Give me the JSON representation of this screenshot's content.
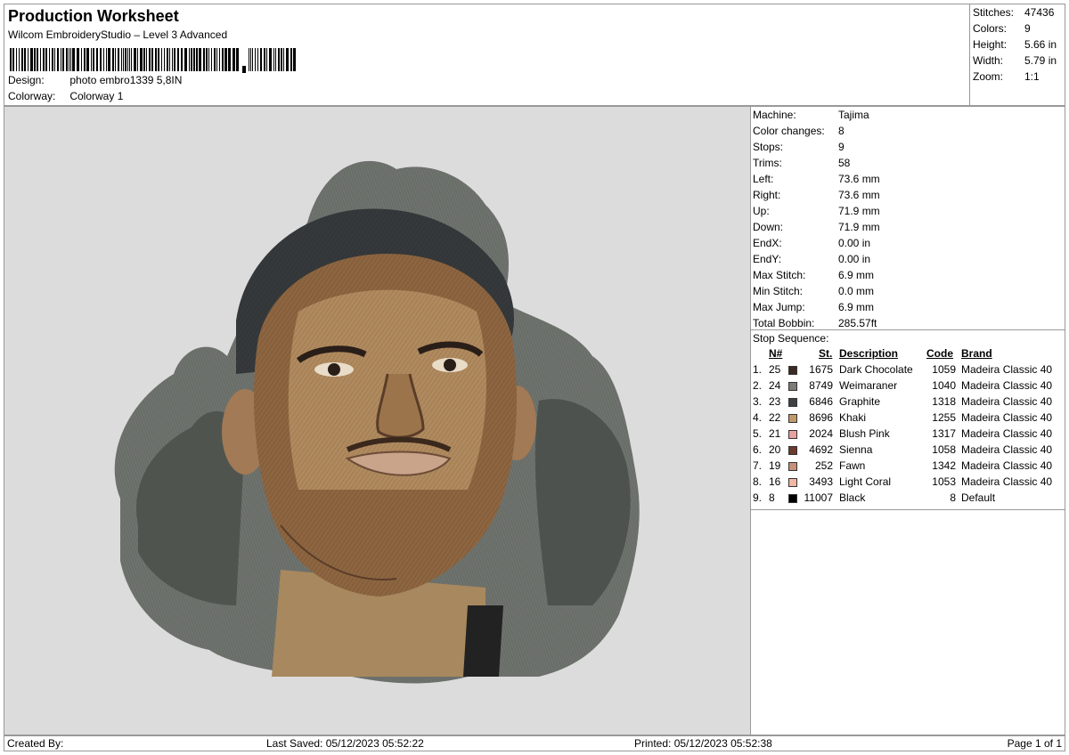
{
  "header": {
    "title": "Production Worksheet",
    "subtitle": "Wilcom EmbroideryStudio – Level 3 Advanced",
    "design_label": "Design:",
    "design_value": "photo embro1339 5,8IN",
    "colorway_label": "Colorway:",
    "colorway_value": "Colorway 1"
  },
  "stats": [
    {
      "label": "Stitches:",
      "value": "47436"
    },
    {
      "label": "Colors:",
      "value": "9"
    },
    {
      "label": "Height:",
      "value": "5.66 in"
    },
    {
      "label": "Width:",
      "value": "5.79 in"
    },
    {
      "label": "Zoom:",
      "value": "1:1"
    }
  ],
  "machine": [
    {
      "label": "Machine:",
      "value": "Tajima"
    },
    {
      "label": "Color changes:",
      "value": "8"
    },
    {
      "label": "Stops:",
      "value": "9"
    },
    {
      "label": "Trims:",
      "value": "58"
    },
    {
      "label": "Left:",
      "value": "73.6 mm"
    },
    {
      "label": "Right:",
      "value": "73.6 mm"
    },
    {
      "label": "Up:",
      "value": "71.9 mm"
    },
    {
      "label": "Down:",
      "value": "71.9 mm"
    },
    {
      "label": "EndX:",
      "value": "0.00 in"
    },
    {
      "label": "EndY:",
      "value": "0.00 in"
    },
    {
      "label": "Max Stitch:",
      "value": "6.9 mm"
    },
    {
      "label": "Min Stitch:",
      "value": "0.0 mm"
    },
    {
      "label": "Max Jump:",
      "value": "6.9 mm"
    },
    {
      "label": "Total Bobbin:",
      "value": "285.57ft"
    }
  ],
  "sequence": {
    "title": "Stop Sequence:",
    "headers": {
      "num": "N#",
      "st": "St.",
      "desc": "Description",
      "code": "Code",
      "brand": "Brand"
    },
    "rows": [
      {
        "idx": "1.",
        "num": "25",
        "color": "#3b2a24",
        "st": "1675",
        "desc": "Dark Chocolate",
        "code": "1059",
        "brand": "Madeira Classic 40"
      },
      {
        "idx": "2.",
        "num": "24",
        "color": "#7d7b76",
        "st": "8749",
        "desc": "Weimaraner",
        "code": "1040",
        "brand": "Madeira Classic 40"
      },
      {
        "idx": "3.",
        "num": "23",
        "color": "#3d4143",
        "st": "6846",
        "desc": "Graphite",
        "code": "1318",
        "brand": "Madeira Classic 40"
      },
      {
        "idx": "4.",
        "num": "22",
        "color": "#c19a6b",
        "st": "8696",
        "desc": "Khaki",
        "code": "1255",
        "brand": "Madeira Classic 40"
      },
      {
        "idx": "5.",
        "num": "21",
        "color": "#e8a2a0",
        "st": "2024",
        "desc": "Blush Pink",
        "code": "1317",
        "brand": "Madeira Classic 40"
      },
      {
        "idx": "6.",
        "num": "20",
        "color": "#6b3a2a",
        "st": "4692",
        "desc": "Sienna",
        "code": "1058",
        "brand": "Madeira Classic 40"
      },
      {
        "idx": "7.",
        "num": "19",
        "color": "#c7907a",
        "st": "252",
        "desc": "Fawn",
        "code": "1342",
        "brand": "Madeira Classic 40"
      },
      {
        "idx": "8.",
        "num": "16",
        "color": "#f0b7a4",
        "st": "3493",
        "desc": "Light Coral",
        "code": "1053",
        "brand": "Madeira Classic 40"
      },
      {
        "idx": "9.",
        "num": "8",
        "color": "#000000",
        "st": "11007",
        "desc": "Black",
        "code": "8",
        "brand": "Default"
      }
    ]
  },
  "footer": {
    "created_by": "Created By:",
    "last_saved": "Last Saved: 05/12/2023 05:52:22",
    "printed": "Printed: 05/12/2023 05:52:38",
    "page": "Page 1 of 1"
  }
}
